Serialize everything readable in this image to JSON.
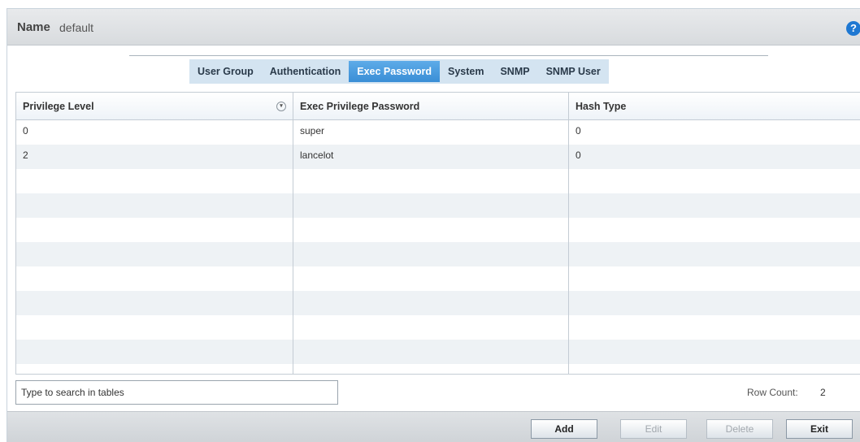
{
  "header": {
    "name_label": "Name",
    "name_value": "default",
    "help_icon": "help-icon"
  },
  "tabs": [
    {
      "label": "User Group",
      "active": false
    },
    {
      "label": "Authentication",
      "active": false
    },
    {
      "label": "Exec Password",
      "active": true
    },
    {
      "label": "System",
      "active": false
    },
    {
      "label": "SNMP",
      "active": false
    },
    {
      "label": "SNMP User",
      "active": false
    }
  ],
  "table": {
    "columns": [
      "Privilege Level",
      "Exec Privilege Password",
      "Hash Type"
    ],
    "rows": [
      [
        "0",
        "super",
        "0"
      ],
      [
        "2",
        "lancelot",
        "0"
      ]
    ]
  },
  "search": {
    "placeholder": "Type to search in tables"
  },
  "row_count": {
    "label": "Row Count:",
    "value": "2"
  },
  "buttons": {
    "add": "Add",
    "edit": "Edit",
    "delete": "Delete",
    "exit": "Exit"
  }
}
